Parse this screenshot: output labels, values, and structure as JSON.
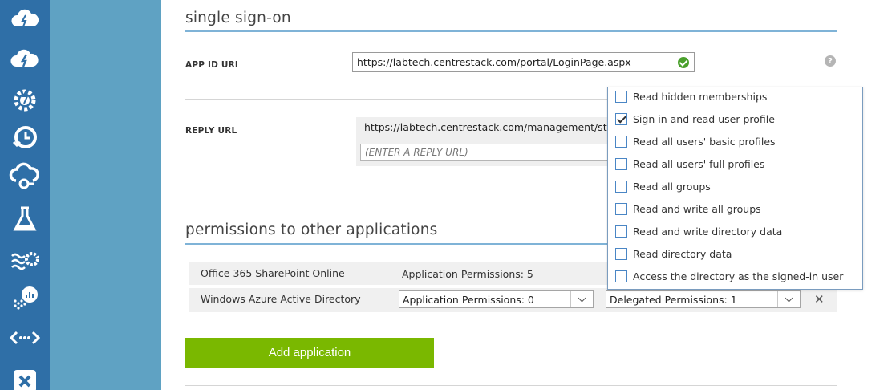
{
  "rail": {
    "icons": [
      "cloud-storm-icon",
      "cloud-bolt-icon",
      "gear-bolt-icon",
      "clock-refresh-icon",
      "cloud-sync-icon",
      "flask-icon",
      "waves-gear-icon",
      "hdinsight-chart-icon",
      "code-arrows-icon",
      "recovery-icon"
    ]
  },
  "sso": {
    "title": "single sign-on",
    "app_id_label": "APP ID URI",
    "app_id_value": "https://labtech.centrestack.com/portal/LoginPage.aspx",
    "help_glyph": "?",
    "reply_label": "REPLY URL",
    "reply_value": "https://labtech.centrestack.com/management/storag",
    "reply_placeholder": "(ENTER A REPLY URL)"
  },
  "permissions": {
    "title": "permissions to other applications",
    "rows": [
      {
        "app": "Office 365 SharePoint Online",
        "app_permissions": "Application Permissions: 5"
      },
      {
        "app": "Windows Azure Active Directory",
        "app_permissions": "Application Permissions: 0",
        "delegated_permissions": "Delegated Permissions: 1"
      }
    ],
    "add_button": "Add application"
  },
  "delegated_dropdown": {
    "options": [
      {
        "label": "Read hidden memberships",
        "checked": false
      },
      {
        "label": "Sign in and read user profile",
        "checked": true
      },
      {
        "label": "Read all users' basic profiles",
        "checked": false
      },
      {
        "label": "Read all users' full profiles",
        "checked": false
      },
      {
        "label": "Read all groups",
        "checked": false
      },
      {
        "label": "Read and write all groups",
        "checked": false
      },
      {
        "label": "Read and write directory data",
        "checked": false
      },
      {
        "label": "Read directory data",
        "checked": false
      },
      {
        "label": "Access the directory as the signed-in user",
        "checked": false
      }
    ]
  },
  "colors": {
    "rail": "#2f6fa7",
    "nav_panel": "#5fa2c3",
    "accent_rule": "#7fb3d7",
    "add_button": "#7ab800",
    "valid": "#4aa02c"
  }
}
